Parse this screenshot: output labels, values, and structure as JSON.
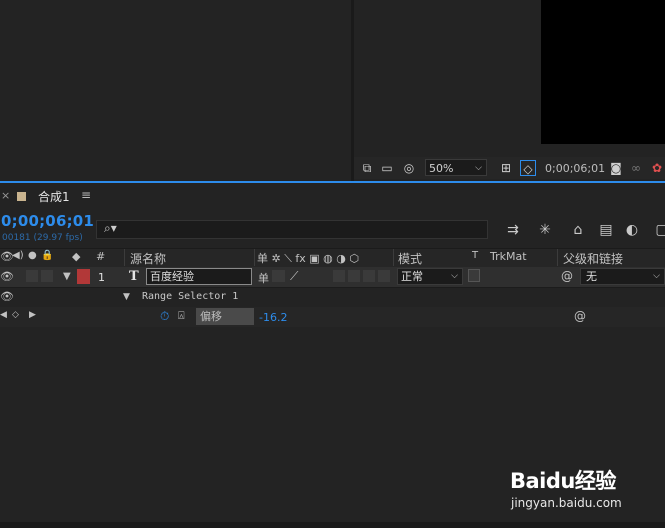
{
  "viewer": {
    "zoom": "50%",
    "time": "0;00;06;01"
  },
  "timeline": {
    "close": "×",
    "comp_tab": "合成1",
    "menu": "≡",
    "timecode": "0;00;06;01",
    "frame_info": "00181 (29.97 fps)",
    "search_placeholder": ""
  },
  "columns": {
    "hash": "#",
    "source_name": "源名称",
    "mode": "模式",
    "t": "T",
    "trkmat": "TrkMat",
    "parent": "父级和链接"
  },
  "layer": {
    "number": "1",
    "type_icon": "T",
    "name": "百度经验",
    "mode": "正常",
    "parent": "无",
    "label_color": "#b23838"
  },
  "range_selector": {
    "label": "Range Selector 1"
  },
  "offset": {
    "name": "偏移",
    "value": "-16.2"
  },
  "watermark": {
    "brand": "Baidu经验",
    "url": "jingyan.baidu.com"
  },
  "colors": {
    "accent": "#2d8ceb"
  }
}
